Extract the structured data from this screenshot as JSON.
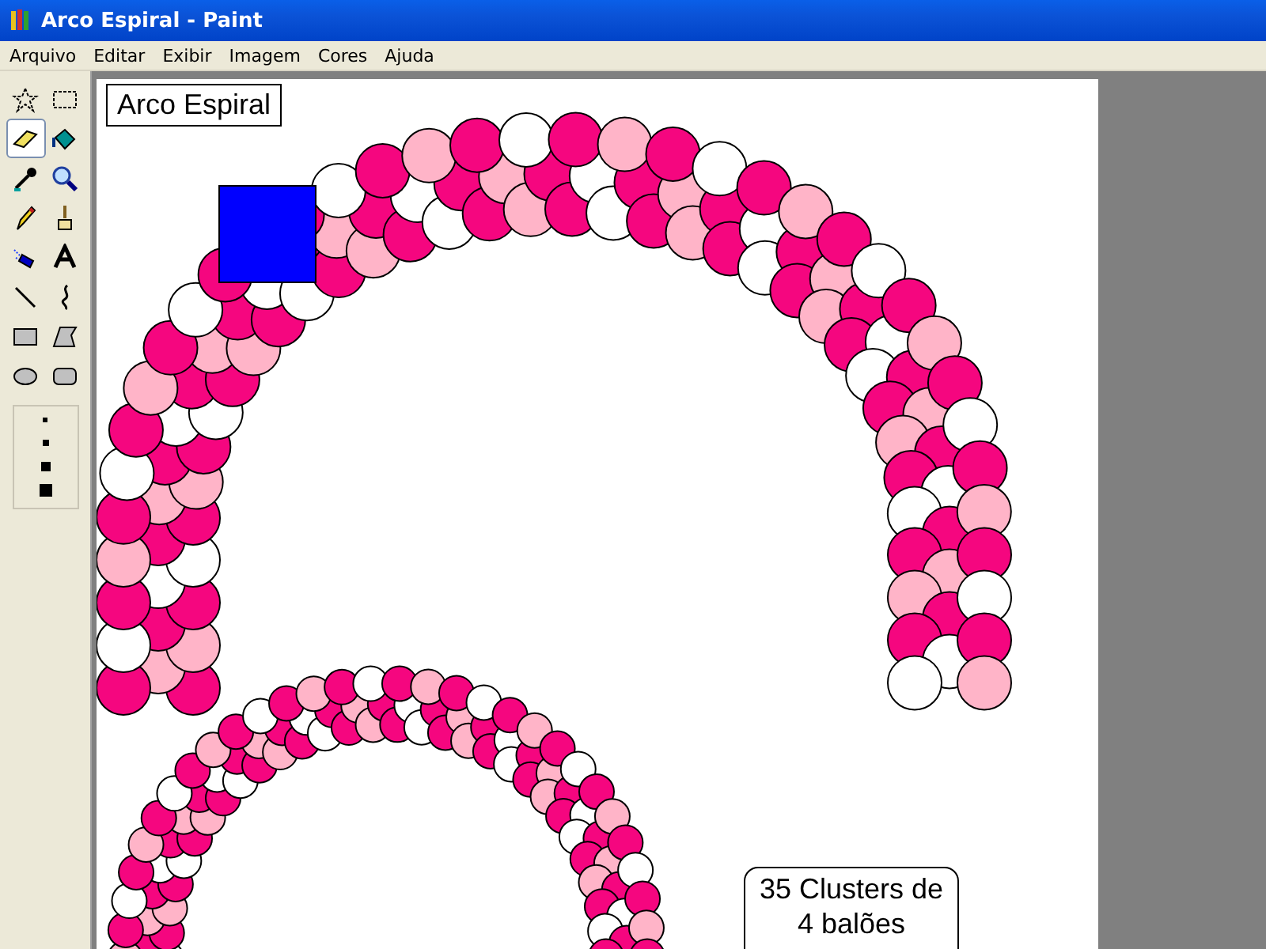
{
  "window": {
    "title": "Arco Espiral - Paint"
  },
  "menu": [
    "Arquivo",
    "Editar",
    "Exibir",
    "Imagem",
    "Cores",
    "Ajuda"
  ],
  "toolbox": {
    "tools": [
      {
        "kind": "free-select",
        "selected": false
      },
      {
        "kind": "rect-select",
        "selected": false
      },
      {
        "kind": "eraser",
        "selected": true
      },
      {
        "kind": "fill",
        "selected": false
      },
      {
        "kind": "picker",
        "selected": false
      },
      {
        "kind": "magnifier",
        "selected": false
      },
      {
        "kind": "pencil",
        "selected": false
      },
      {
        "kind": "brush",
        "selected": false
      },
      {
        "kind": "airbrush",
        "selected": false
      },
      {
        "kind": "text",
        "selected": false
      },
      {
        "kind": "line",
        "selected": false
      },
      {
        "kind": "curve",
        "selected": false
      },
      {
        "kind": "rectangle",
        "selected": false
      },
      {
        "kind": "polygon",
        "selected": false
      },
      {
        "kind": "ellipse",
        "selected": false
      },
      {
        "kind": "rounded-rect",
        "selected": false
      }
    ]
  },
  "canvas": {
    "title_label": "Arco Espiral",
    "note_lines": [
      "35 Clusters de",
      "4 balões"
    ]
  }
}
